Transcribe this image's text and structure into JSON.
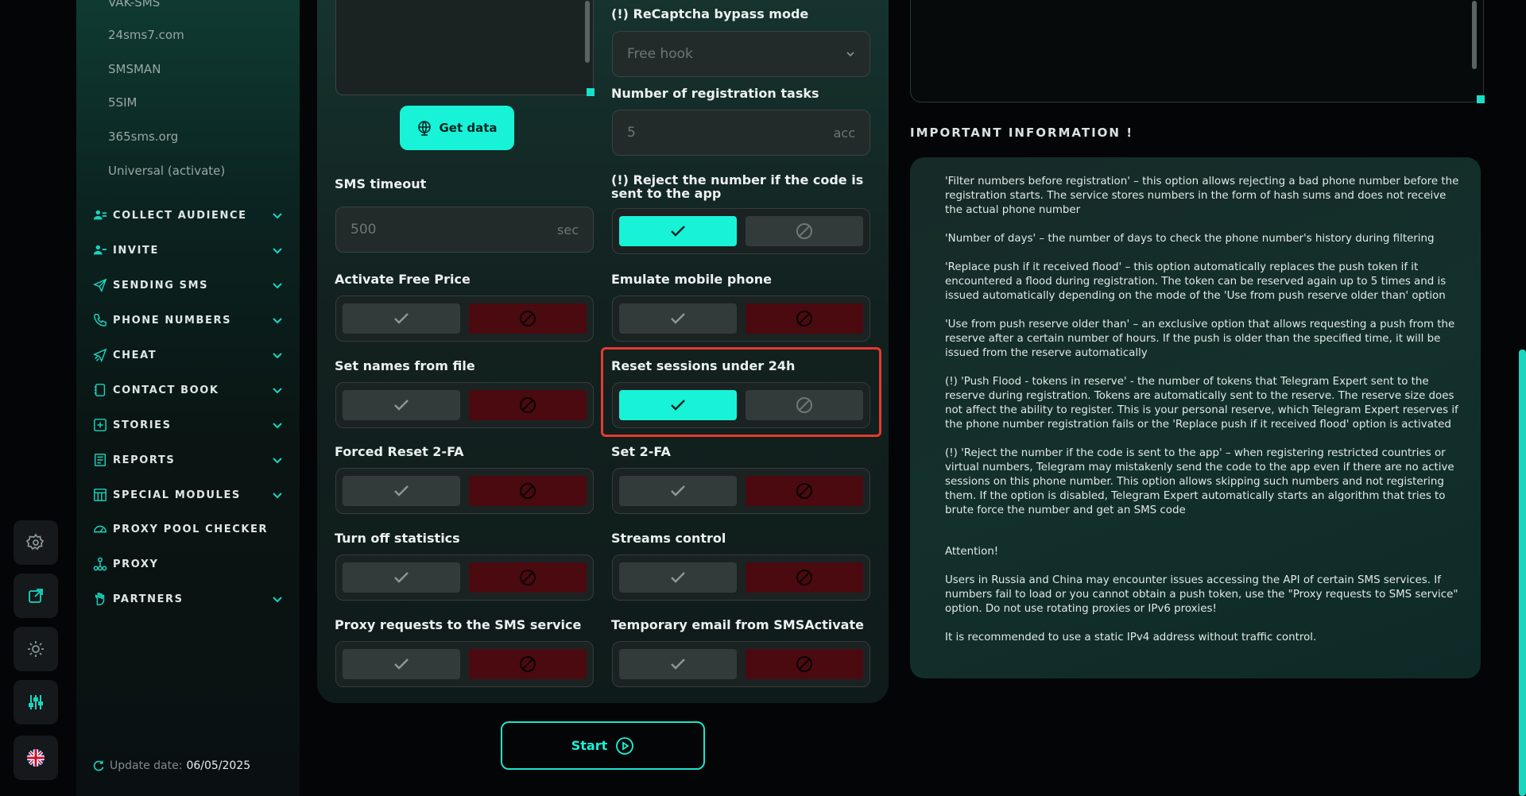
{
  "sidebar": {
    "partial_item": "VAK-SMS",
    "sub_items": [
      "24sms7.com",
      "SMSMAN",
      "5SIM",
      "365sms.org",
      "Universal (activate)"
    ],
    "nav": [
      {
        "label": "COLLECT AUDIENCE",
        "icon": "users-icon",
        "chevron": true
      },
      {
        "label": "INVITE",
        "icon": "user-plus-icon",
        "chevron": true
      },
      {
        "label": "SENDING SMS",
        "icon": "send-icon",
        "chevron": true
      },
      {
        "label": "PHONE NUMBERS",
        "icon": "phone-icon",
        "chevron": true
      },
      {
        "label": "CHEAT",
        "icon": "send-boost-icon",
        "chevron": true
      },
      {
        "label": "CONTACT BOOK",
        "icon": "book-icon",
        "chevron": true
      },
      {
        "label": "STORIES",
        "icon": "plus-square-icon",
        "chevron": true
      },
      {
        "label": "REPORTS",
        "icon": "report-icon",
        "chevron": true
      },
      {
        "label": "SPECIAL MODULES",
        "icon": "modules-icon",
        "chevron": true
      },
      {
        "label": "PROXY POOL CHECKER",
        "icon": "gauge-icon",
        "chevron": false
      },
      {
        "label": "PROXY",
        "icon": "network-icon",
        "chevron": false
      },
      {
        "label": "PARTNERS",
        "icon": "hand-icon",
        "chevron": true
      }
    ],
    "update_label": "Update date:",
    "update_value": "06/05/2025"
  },
  "main": {
    "get_data_label": "Get data",
    "recaptcha_label": "(!) ReCaptcha bypass mode",
    "recaptcha_value": "Free hook",
    "reg_tasks_label": "Number of registration tasks",
    "reg_tasks_placeholder": "5",
    "reg_tasks_unit": "acc",
    "sms_timeout_label": "SMS timeout",
    "sms_timeout_placeholder": "500",
    "sms_timeout_unit": "sec",
    "reject_label": "(!) Reject the number if the code is sent to the app",
    "toggles": {
      "reject_number": true,
      "activate_free_price": false,
      "emulate_mobile": false,
      "set_names_from_file": false,
      "reset_sessions_24h": true,
      "forced_reset_2fa": false,
      "set_2fa": false,
      "turn_off_statistics": false,
      "streams_control": false,
      "proxy_requests_sms": false,
      "temporary_email": false
    },
    "labels": {
      "activate_free_price": "Activate Free Price",
      "emulate_mobile": "Emulate mobile phone",
      "set_names_from_file": "Set names from file",
      "reset_sessions_24h": "Reset sessions under 24h",
      "forced_reset_2fa": "Forced Reset 2-FA",
      "set_2fa": "Set 2-FA",
      "turn_off_statistics": "Turn off statistics",
      "streams_control": "Streams control",
      "proxy_requests_sms": "Proxy requests to the SMS service",
      "temporary_email": "Temporary email from SMSActivate"
    },
    "start_label": "Start"
  },
  "info": {
    "title": "IMPORTANT INFORMATION !",
    "paragraphs": [
      "'Filter numbers before registration' – this option allows rejecting a bad phone number before the registration starts. The service stores numbers in the form of hash sums and does not receive the actual phone number",
      "'Number of days' – the number of days to check the phone number's history during filtering",
      "'Replace push if it received flood' – this option automatically replaces the push token if it encountered a flood during registration. The token can be reserved again up to 5 times and is issued automatically depending on the mode of the 'Use from push reserve older than' option",
      "'Use from push reserve older than' – an exclusive option that allows requesting a push from the reserve after a certain number of hours. If the push is older than the specified time, it will be issued from the reserve automatically",
      "(!) 'Push Flood - tokens in reserve' - the number of tokens that Telegram Expert sent to the reserve during registration. Tokens are automatically sent to the reserve. The reserve size does not affect the ability to register. This is your personal reserve, which Telegram Expert reserves if the phone number registration fails or the 'Replace push if it received flood' option is activated",
      "(!) 'Reject the number if the code is sent to the app' – when registering restricted countries or virtual numbers, Telegram may mistakenly send the code to the app even if there are no active sessions on this phone number. This option allows skipping such numbers and not registering them. If the option is disabled, Telegram Expert automatically starts an algorithm that tries to brute force the number and get an SMS code",
      "Attention!",
      "Users in Russia and China may encounter issues accessing the API of certain SMS services. If numbers fail to load or you cannot obtain a push token, use the \"Proxy requests to SMS service\" option. Do not use rotating proxies or IPv6 proxies!",
      "It is recommended to use a static IPv4 address without traffic control."
    ]
  },
  "colors": {
    "accent": "#18f3d8",
    "negative": "#4a0a10",
    "highlight": "#e53a2e"
  }
}
